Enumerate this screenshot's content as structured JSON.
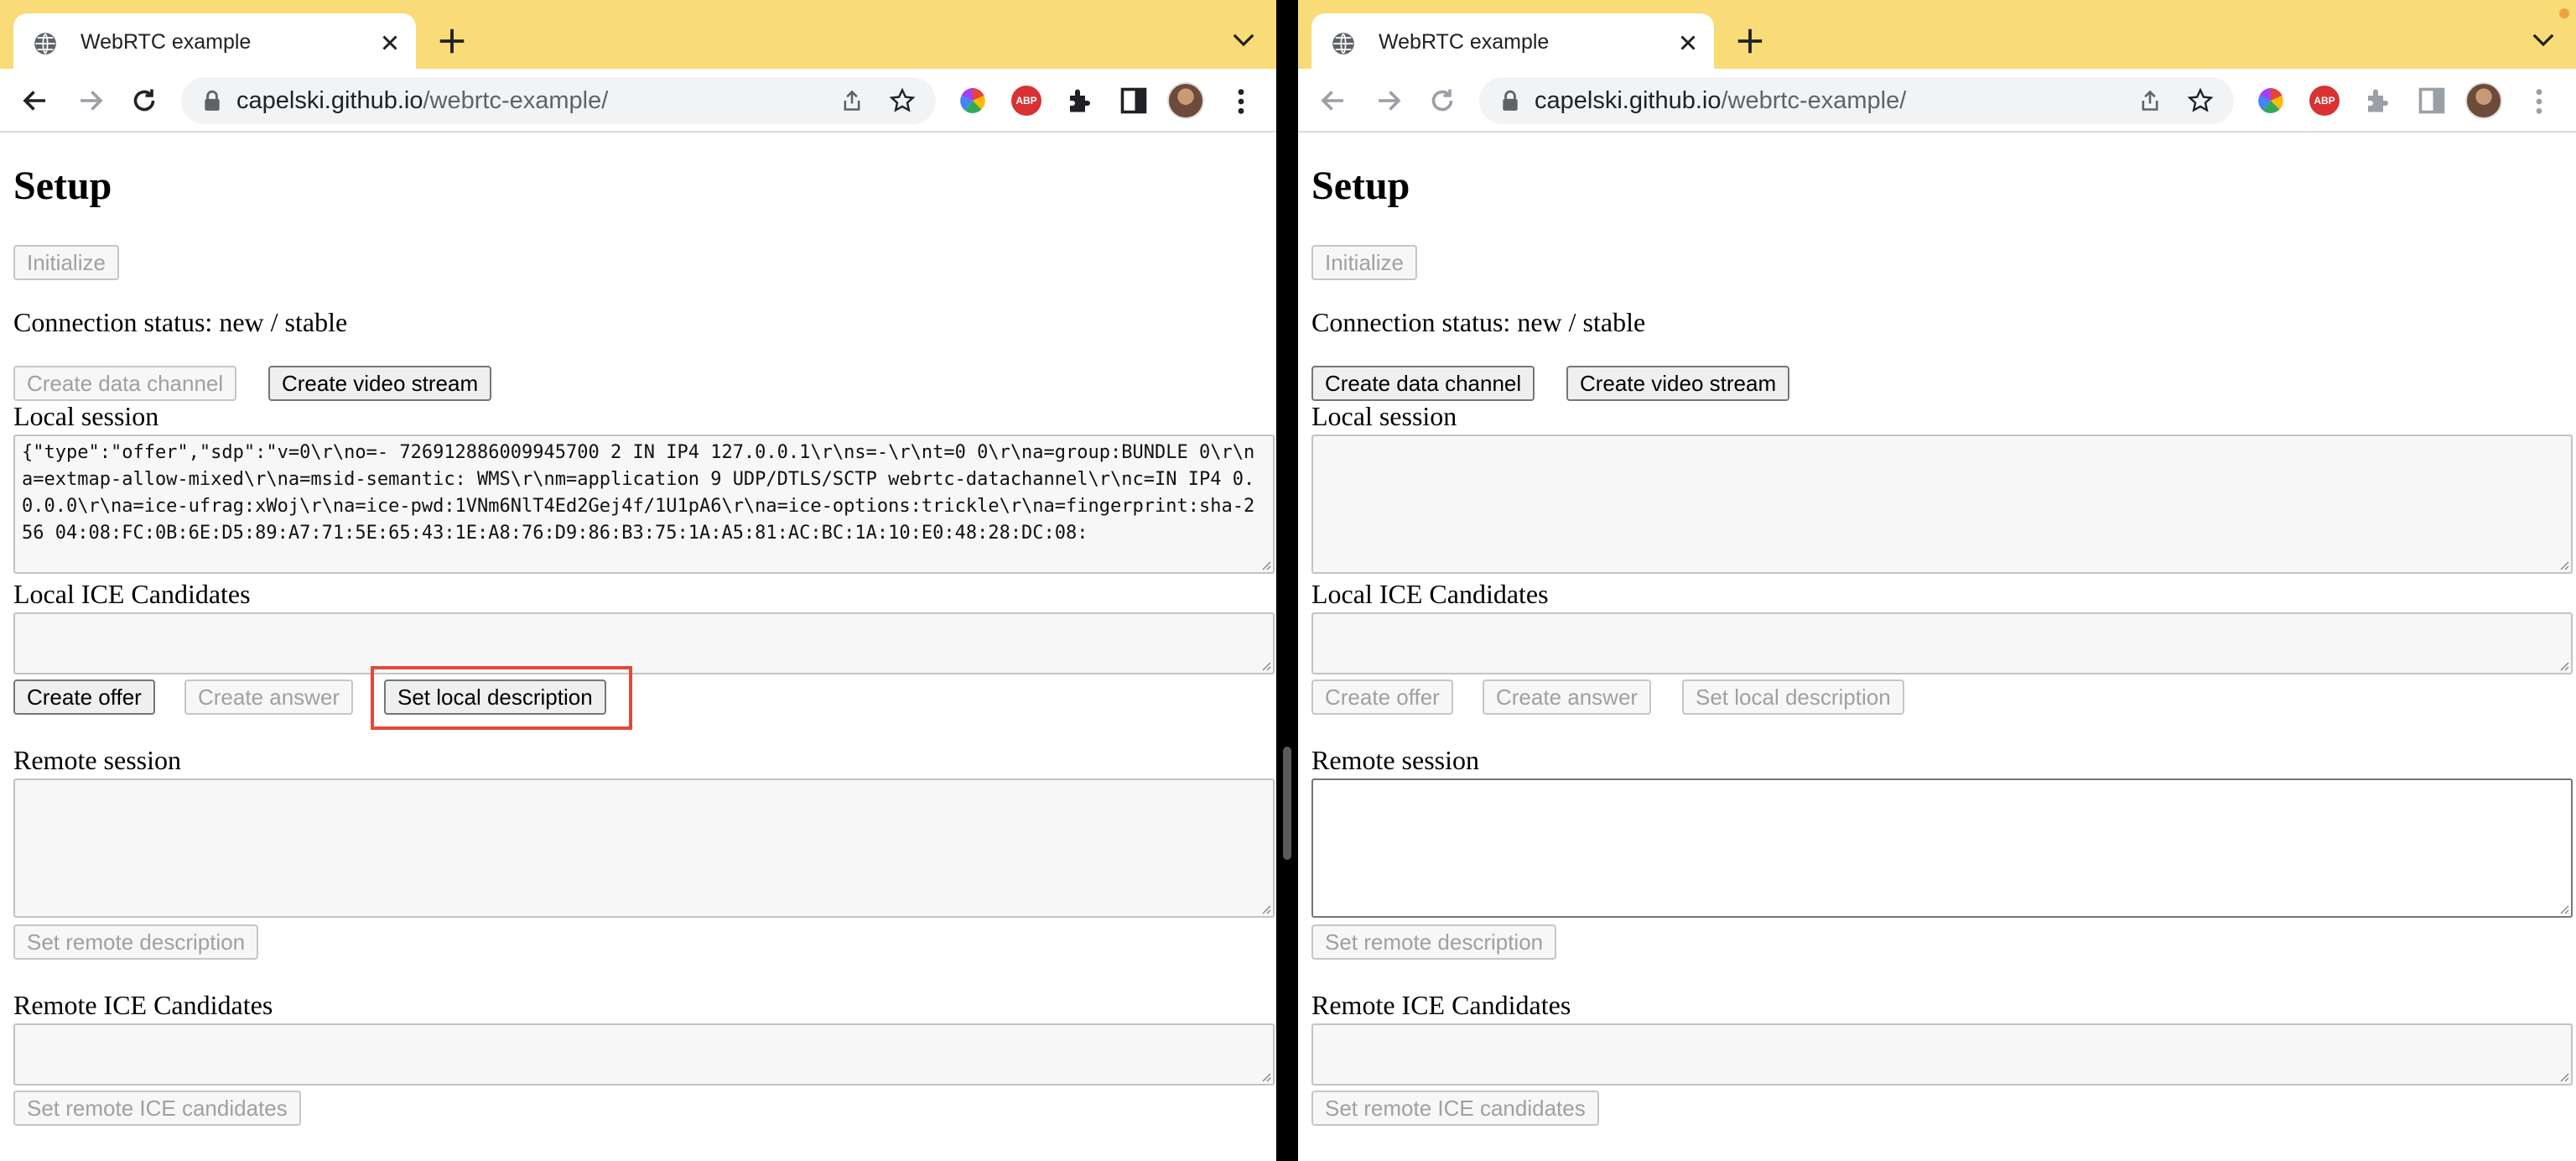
{
  "left": {
    "tab_title": "WebRTC example",
    "url_host": "capelski.github.io",
    "url_path": "/webrtc-example/",
    "heading": "Setup",
    "initialize_label": "Initialize",
    "connection_status": "Connection status: new / stable",
    "create_data_channel_label": "Create data channel",
    "create_video_stream_label": "Create video stream",
    "local_session_label": "Local session",
    "local_session_value": "{\"type\":\"offer\",\"sdp\":\"v=0\\r\\no=- 726912886009945700 2 IN IP4 127.0.0.1\\r\\ns=-\\r\\nt=0 0\\r\\na=group:BUNDLE 0\\r\\na=extmap-allow-mixed\\r\\na=msid-semantic: WMS\\r\\nm=application 9 UDP/DTLS/SCTP webrtc-datachannel\\r\\nc=IN IP4 0.0.0.0\\r\\na=ice-ufrag:xWoj\\r\\na=ice-pwd:1VNm6NlT4Ed2Gej4f/1U1pA6\\r\\na=ice-options:trickle\\r\\na=fingerprint:sha-256 04:08:FC:0B:6E:D5:89:A7:71:5E:65:43:1E:A8:76:D9:86:B3:75:1A:A5:81:AC:BC:1A:10:E0:48:28:DC:08:",
    "local_ice_label": "Local ICE Candidates",
    "create_offer_label": "Create offer",
    "create_answer_label": "Create answer",
    "set_local_description_label": "Set local description",
    "remote_session_label": "Remote session",
    "set_remote_description_label": "Set remote description",
    "remote_ice_label": "Remote ICE Candidates",
    "set_remote_ice_label": "Set remote ICE candidates"
  },
  "right": {
    "tab_title": "WebRTC example",
    "url_host": "capelski.github.io",
    "url_path": "/webrtc-example/",
    "heading": "Setup",
    "initialize_label": "Initialize",
    "connection_status": "Connection status: new / stable",
    "create_data_channel_label": "Create data channel",
    "create_video_stream_label": "Create video stream",
    "local_session_label": "Local session",
    "local_ice_label": "Local ICE Candidates",
    "create_offer_label": "Create offer",
    "create_answer_label": "Create answer",
    "set_local_description_label": "Set local description",
    "remote_session_label": "Remote session",
    "set_remote_description_label": "Set remote description",
    "remote_ice_label": "Remote ICE Candidates",
    "set_remote_ice_label": "Set remote ICE candidates"
  },
  "extensions": {
    "abp_badge": "ABP"
  },
  "colors": {
    "tabstrip": "#f9dc78",
    "highlight": "#e04a3b",
    "abp": "#d83232"
  }
}
